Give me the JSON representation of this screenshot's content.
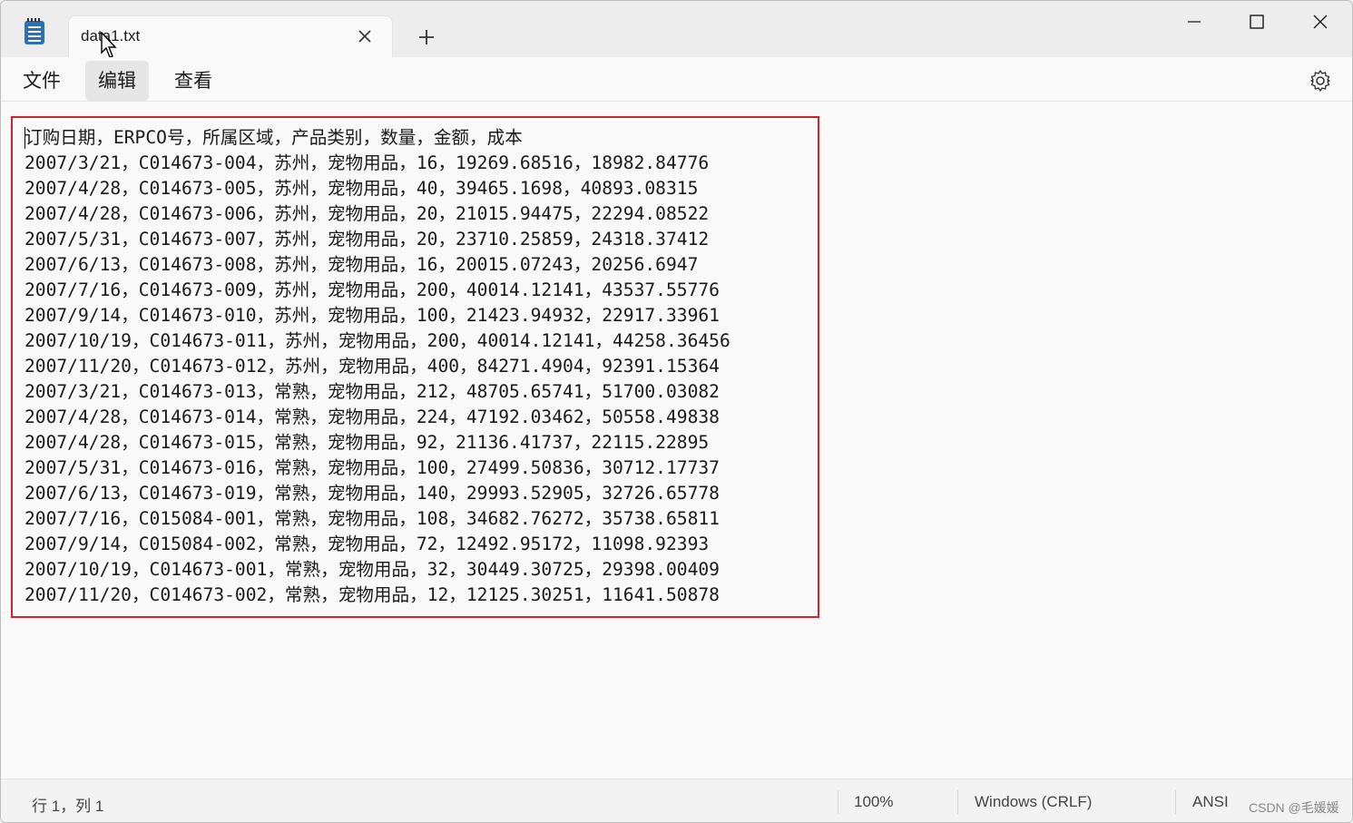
{
  "window": {
    "tab_title": "data1.txt",
    "tab_close_icon": "close-icon",
    "new_tab_icon": "plus-icon",
    "minimize_icon": "minimize-icon",
    "maximize_icon": "maximize-icon",
    "close_icon": "close-icon"
  },
  "menu": {
    "file": "文件",
    "edit": "编辑",
    "view": "查看",
    "settings_icon": "gear-icon"
  },
  "editor": {
    "lines": [
      "订购日期，ERPCO号，所属区域，产品类别，数量，金额，成本",
      "2007/3/21，C014673-004，苏州，宠物用品，16，19269.68516，18982.84776",
      "2007/4/28，C014673-005，苏州，宠物用品，40，39465.1698，40893.08315",
      "2007/4/28，C014673-006，苏州，宠物用品，20，21015.94475，22294.08522",
      "2007/5/31，C014673-007，苏州，宠物用品，20，23710.25859，24318.37412",
      "2007/6/13，C014673-008，苏州，宠物用品，16，20015.07243，20256.6947",
      "2007/7/16，C014673-009，苏州，宠物用品，200，40014.12141，43537.55776",
      "2007/9/14，C014673-010，苏州，宠物用品，100，21423.94932，22917.33961",
      "2007/10/19，C014673-011，苏州，宠物用品，200，40014.12141，44258.36456",
      "2007/11/20，C014673-012，苏州，宠物用品，400，84271.4904，92391.15364",
      "2007/3/21，C014673-013，常熟，宠物用品，212，48705.65741，51700.03082",
      "2007/4/28，C014673-014，常熟，宠物用品，224，47192.03462，50558.49838",
      "2007/4/28，C014673-015，常熟，宠物用品，92，21136.41737，22115.22895",
      "2007/5/31，C014673-016，常熟，宠物用品，100，27499.50836，30712.17737",
      "2007/6/13，C014673-019，常熟，宠物用品，140，29993.52905，32726.65778",
      "2007/7/16，C015084-001，常熟，宠物用品，108，34682.76272，35738.65811",
      "2007/9/14，C015084-002，常熟，宠物用品，72，12492.95172，11098.92393",
      "2007/10/19，C014673-001，常熟，宠物用品，32，30449.30725，29398.00409",
      "2007/11/20，C014673-002，常熟，宠物用品，12，12125.30251，11641.50878"
    ],
    "highlight_color": "#d0212e"
  },
  "status": {
    "position": "行 1，列 1",
    "zoom": "100%",
    "line_ending": "Windows (CRLF)",
    "encoding": "ANSI"
  },
  "watermark": "CSDN @毛媛媛"
}
